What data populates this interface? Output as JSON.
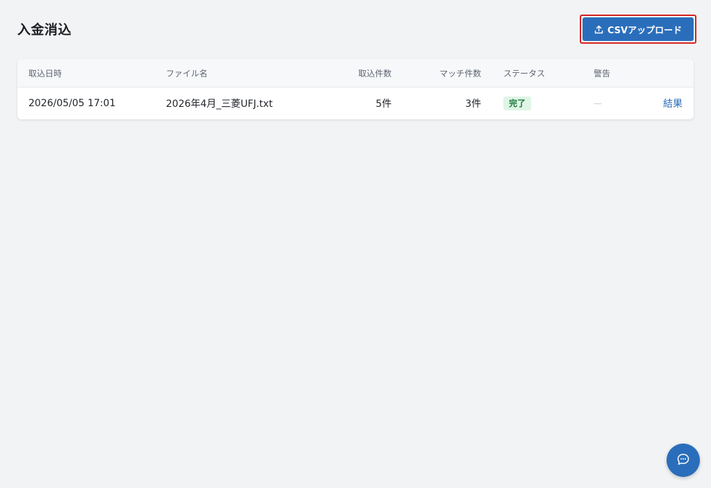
{
  "page": {
    "title": "入金消込"
  },
  "toolbar": {
    "upload_label": "CSVアップロード",
    "upload_icon": "upload-icon"
  },
  "table": {
    "headers": {
      "date": "取込日時",
      "file": "ファイル名",
      "count": "取込件数",
      "match": "マッチ件数",
      "status": "ステータス",
      "warning": "警告"
    },
    "rows": [
      {
        "date": "2026/05/05 17:01",
        "file": "2026年4月_三菱UFJ.txt",
        "count": "5件",
        "match": "3件",
        "status": "完了",
        "warning": "—",
        "action": "結果"
      }
    ]
  },
  "chat": {
    "icon": "chat-bubble-icon"
  },
  "colors": {
    "accent": "#2a6ebb",
    "highlight_outline": "#d62020",
    "status_success_bg": "#dff5e5",
    "status_success_text": "#1e7a3c",
    "background": "#f2f3f5"
  }
}
